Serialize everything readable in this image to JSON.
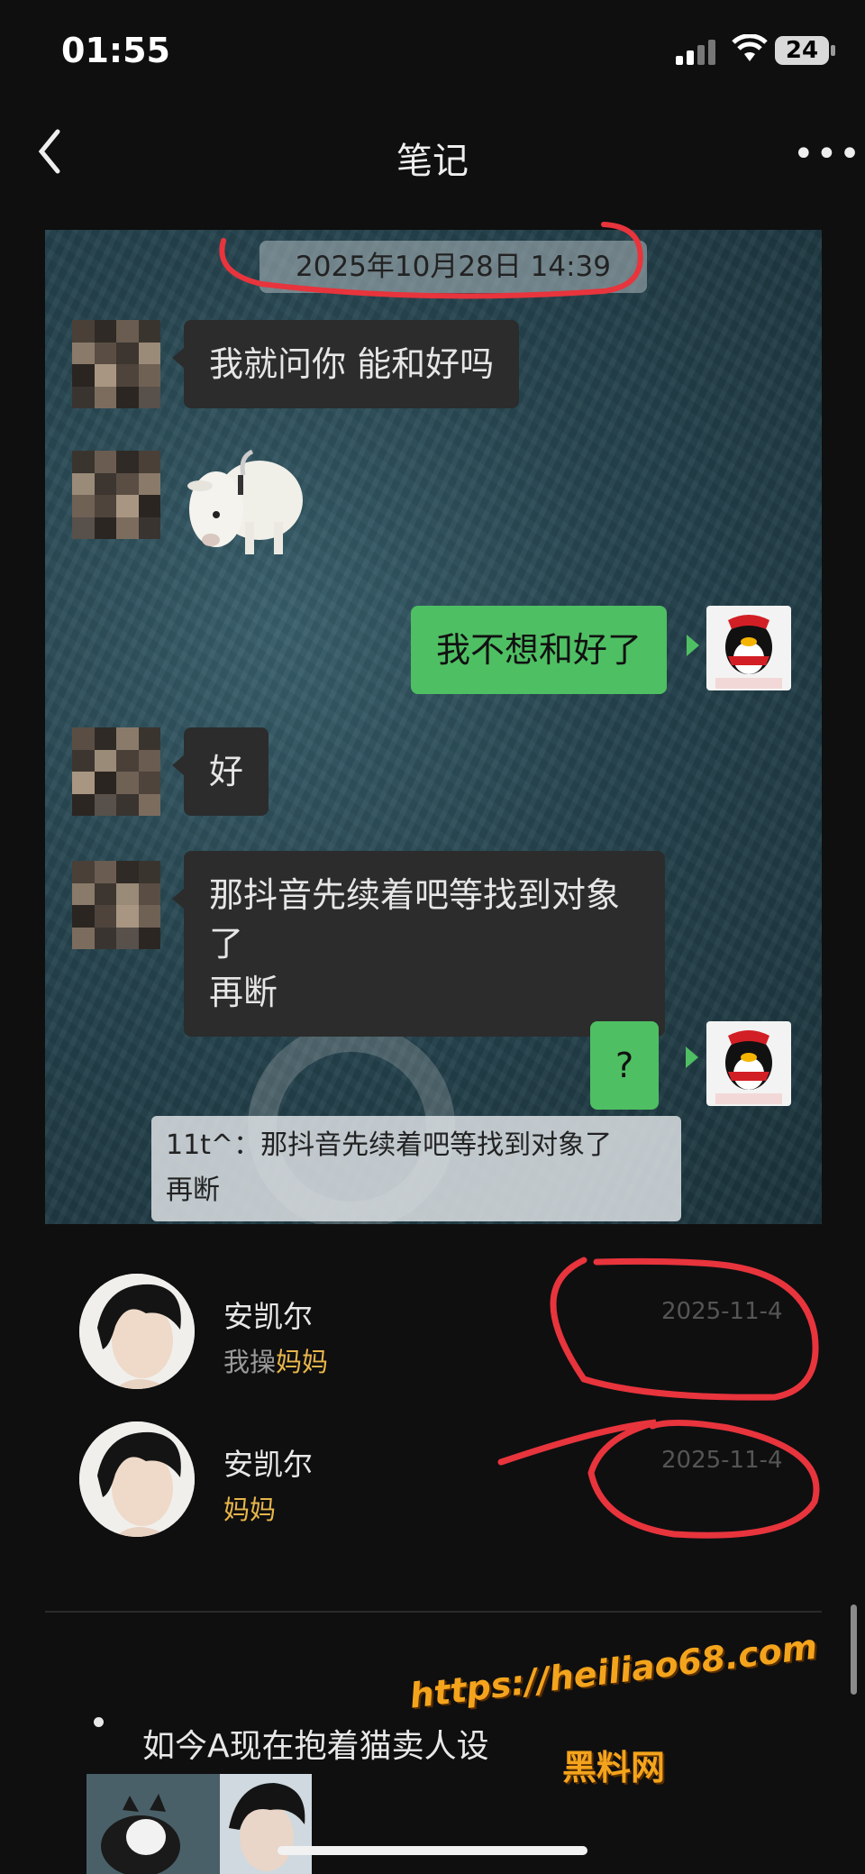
{
  "status": {
    "time": "01:55",
    "battery": "24"
  },
  "nav": {
    "title": "笔记"
  },
  "chat": {
    "timestamp": "2025年10月28日 14:39",
    "msg1": "我就问你 能和好吗",
    "msg2": "我不想和好了",
    "msg3": "好",
    "msg4_line1": "那抖音先续着吧等找到对象了",
    "msg4_line2": "再断",
    "msg5": "?",
    "quote_line1": "11t^：那抖音先续着吧等找到对象了",
    "quote_line2": "再断"
  },
  "comments": [
    {
      "name": "安凯尔",
      "prefix": "我操",
      "highlight": "妈妈",
      "date": "2025-11-4"
    },
    {
      "name": "安凯尔",
      "prefix": "",
      "highlight": "妈妈",
      "date": "2025-11-4"
    }
  ],
  "body_text": {
    "bullet": "如今A现在抱着猫卖人设"
  },
  "watermark": {
    "url": "https://heiliao68.com",
    "site": "黑料网"
  },
  "colors": {
    "accent_green": "#4fbf63",
    "highlight_yellow": "#e8b64a",
    "annotation_red": "#e8343c"
  }
}
